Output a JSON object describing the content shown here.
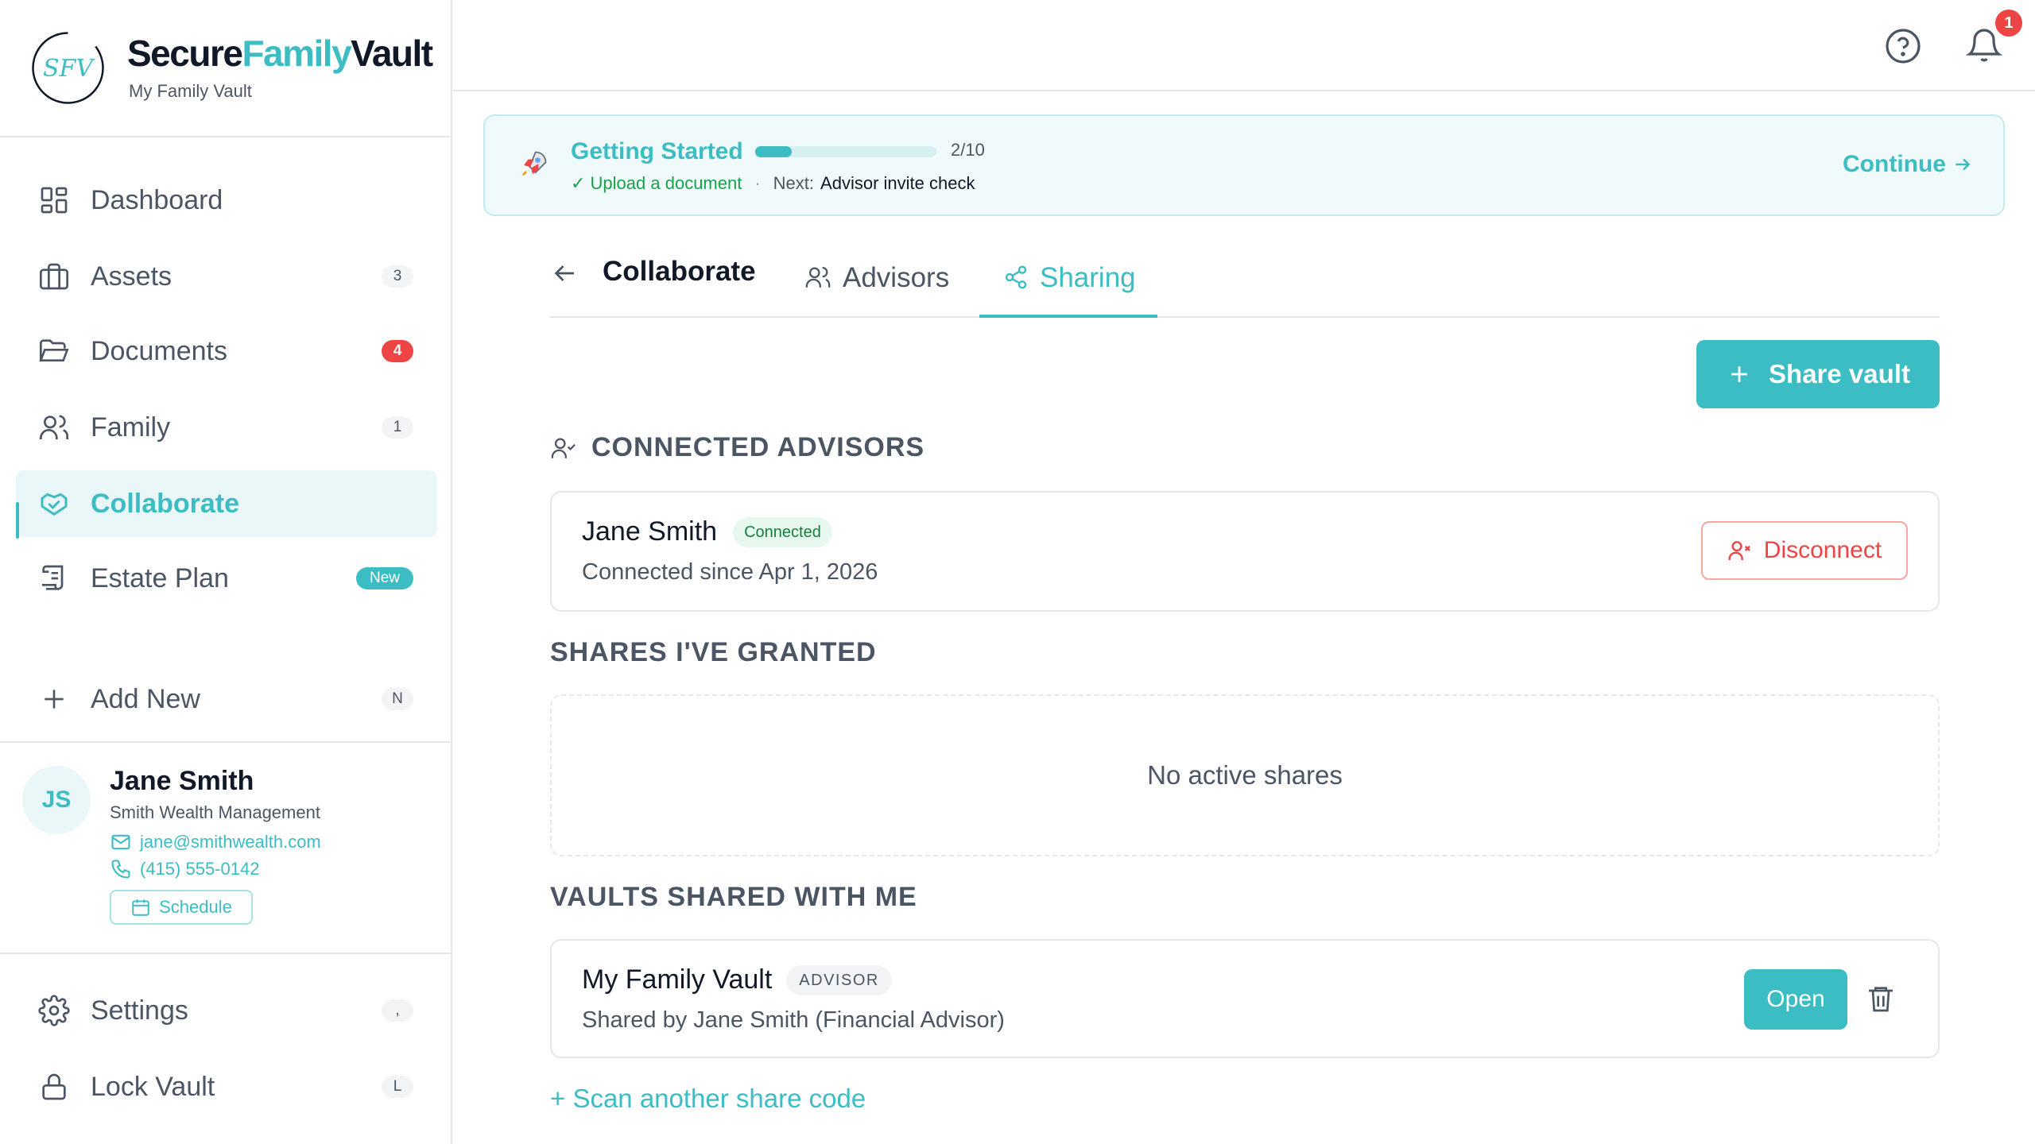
{
  "brand": {
    "name_part1": "Secure",
    "name_part2": "Family",
    "name_part3": "Vault",
    "subtitle": "My Family Vault",
    "logo_monogram": "SFV",
    "logo_icon": "monogram-logo-icon"
  },
  "sidebar": {
    "items": [
      {
        "label": "Dashboard",
        "icon": "dashboard-grid-icon",
        "badge": ""
      },
      {
        "label": "Assets",
        "icon": "briefcase-icon",
        "badge": "3"
      },
      {
        "label": "Documents",
        "icon": "folder-open-icon",
        "badge": "4"
      },
      {
        "label": "Family",
        "icon": "users-icon",
        "badge": "1"
      },
      {
        "label": "Collaborate",
        "icon": "handshake-icon",
        "badge": "",
        "active": true
      },
      {
        "label": "Estate Plan",
        "icon": "scroll-icon",
        "badge": "New"
      }
    ],
    "add_new": {
      "label": "Add New",
      "shortcut": "N"
    },
    "settings": {
      "label": "Settings",
      "shortcut": ","
    },
    "lock": {
      "label": "Lock Vault",
      "shortcut": "L"
    }
  },
  "contact": {
    "initials": "JS",
    "name": "Jane Smith",
    "org": "Smith Wealth Management",
    "email": "jane@smithwealth.com",
    "phone": "(415) 555-0142",
    "schedule_label": "Schedule"
  },
  "topbar": {
    "notification_count": "1"
  },
  "getting_started": {
    "title": "Getting Started",
    "progress_text": "2/10",
    "progress_fraction": 0.2,
    "done_item": "✓ Upload a document",
    "separator": "·",
    "next_label": "Next:",
    "next_item": "Advisor invite check",
    "continue_label": "Continue"
  },
  "tabs": {
    "title": "Collaborate",
    "items": [
      {
        "label": "Advisors",
        "icon": "users-icon"
      },
      {
        "label": "Sharing",
        "icon": "share-nodes-icon",
        "active": true
      }
    ]
  },
  "main": {
    "share_vault_label": "Share vault",
    "connected_heading": "CONNECTED ADVISORS",
    "advisor": {
      "name": "Jane Smith",
      "status": "Connected",
      "since": "Connected since Apr 1, 2026",
      "disconnect_label": "Disconnect"
    },
    "granted_heading": "SHARES I'VE GRANTED",
    "granted_empty": "No active shares",
    "shared_heading": "VAULTS SHARED WITH ME",
    "shared_vault": {
      "name": "My Family Vault",
      "role": "ADVISOR",
      "shared_by": "Shared by Jane Smith (Financial Advisor)",
      "open_label": "Open"
    },
    "scan_link": "+ Scan another share code"
  },
  "colors": {
    "accent": "#3cbcc3",
    "danger": "#ef4444",
    "success": "#16a34a"
  }
}
